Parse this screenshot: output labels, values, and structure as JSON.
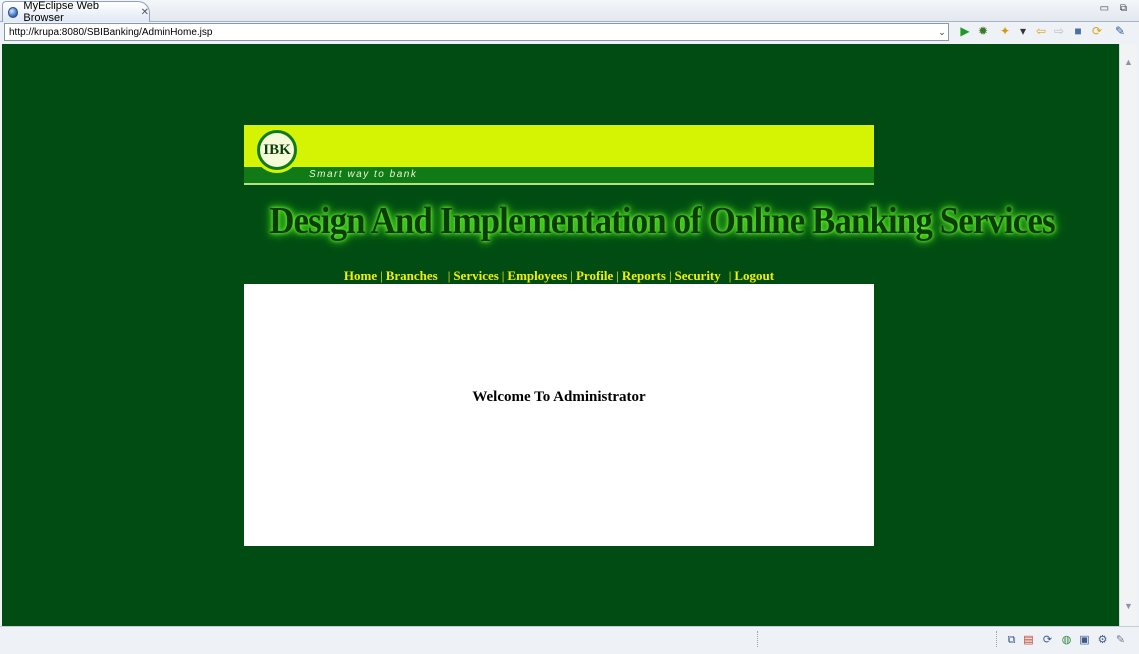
{
  "window": {
    "tab_title": "MyEclipse Web Browser",
    "tab_close": "✕",
    "controls": "▭ ⧉"
  },
  "addressbar": {
    "url": "http://krupa:8080/SBIBanking/AdminHome.jsp",
    "dropdown_glyph": "⌄"
  },
  "toolbar": [
    {
      "icon": "run-icon",
      "glyph": "▶",
      "color": "#1e9a2a"
    },
    {
      "icon": "debug-icon",
      "glyph": "✹",
      "color": "#3a7a2a"
    },
    {
      "icon": "favorites-icon",
      "glyph": "✦",
      "color": "#d29a10"
    },
    {
      "icon": "dropdown-icon",
      "glyph": "▾",
      "color": "#333333"
    },
    {
      "icon": "back-icon",
      "glyph": "⇦",
      "color": "#d9a21a"
    },
    {
      "icon": "forward-icon",
      "glyph": "⇨",
      "color": "#b9bfc8"
    },
    {
      "icon": "stop-icon",
      "glyph": "■",
      "color": "#4a6fa8"
    },
    {
      "icon": "refresh-icon",
      "glyph": "⟳",
      "color": "#d9a21a"
    },
    {
      "icon": "browser-settings-icon",
      "glyph": "✎",
      "color": "#2b5ba8"
    }
  ],
  "page": {
    "logo_text": "IBK",
    "tagline": "Smart way to bank",
    "title": "Design And Implementation of  Online Banking Services",
    "nav": [
      "Home",
      "Branches",
      "Services",
      "Employees",
      "Profile",
      "Reports",
      "Security",
      "Logout"
    ],
    "nav_separator": "|",
    "welcome": "Welcome To Administrator"
  },
  "colors": {
    "page_bg": "#014c12",
    "banner_lime": "#d4f404",
    "banner_green": "#0f7a16",
    "nav_text": "#f0f000"
  }
}
